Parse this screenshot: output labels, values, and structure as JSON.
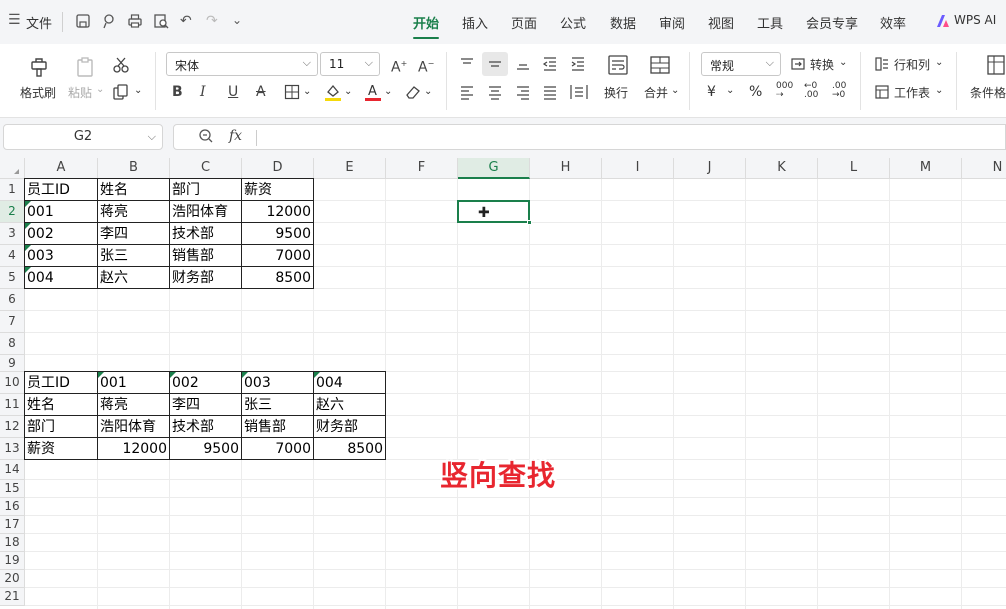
{
  "menubar": {
    "file_label": "文件",
    "menu_icon": "hamburger-icon",
    "tabs": [
      {
        "label": "开始",
        "active": true
      },
      {
        "label": "插入"
      },
      {
        "label": "页面"
      },
      {
        "label": "公式"
      },
      {
        "label": "数据"
      },
      {
        "label": "审阅"
      },
      {
        "label": "视图"
      },
      {
        "label": "工具"
      },
      {
        "label": "会员专享"
      },
      {
        "label": "效率"
      }
    ],
    "wps_ai": "WPS AI"
  },
  "ribbon": {
    "format_painter": "格式刷",
    "paste": "粘贴",
    "font_name": "宋体",
    "font_size": "11",
    "wrap": "换行",
    "merge": "合并",
    "number_format": "常规",
    "convert": "转换",
    "rows_cols": "行和列",
    "worksheet": "工作表",
    "conditional": "条件格",
    "currency_symbol": "¥",
    "percent_symbol": "%",
    "accent_color": "#1a7f4b",
    "font_color": "#e8262f",
    "highlight_color": "#f5d90a"
  },
  "formula_bar": {
    "name_box": "G2",
    "fx_label": "fx",
    "content": ""
  },
  "sheet": {
    "columns": [
      "A",
      "B",
      "C",
      "D",
      "E",
      "F",
      "G",
      "H",
      "I",
      "J",
      "K",
      "L",
      "M",
      "N"
    ],
    "selected_column": "G",
    "rows": [
      "1",
      "2",
      "3",
      "4",
      "5",
      "6",
      "7",
      "8",
      "9",
      "10",
      "11",
      "12",
      "13",
      "14",
      "15",
      "16",
      "17",
      "18",
      "19",
      "20",
      "21"
    ],
    "selected_row": "2",
    "table1": [
      [
        "员工ID",
        "姓名",
        "部门",
        "薪资"
      ],
      [
        "001",
        "蒋亮",
        "浩阳体育",
        "12000"
      ],
      [
        "002",
        "李四",
        "技术部",
        "9500"
      ],
      [
        "003",
        "张三",
        "销售部",
        "7000"
      ],
      [
        "004",
        "赵六",
        "财务部",
        "8500"
      ]
    ],
    "table2": [
      [
        "员工ID",
        "001",
        "002",
        "003",
        "004"
      ],
      [
        "姓名",
        "蒋亮",
        "李四",
        "张三",
        "赵六"
      ],
      [
        "部门",
        "浩阳体育",
        "技术部",
        "销售部",
        "财务部"
      ],
      [
        "薪资",
        "12000",
        "9500",
        "7000",
        "8500"
      ]
    ]
  },
  "overlay_text": "竖向查找"
}
